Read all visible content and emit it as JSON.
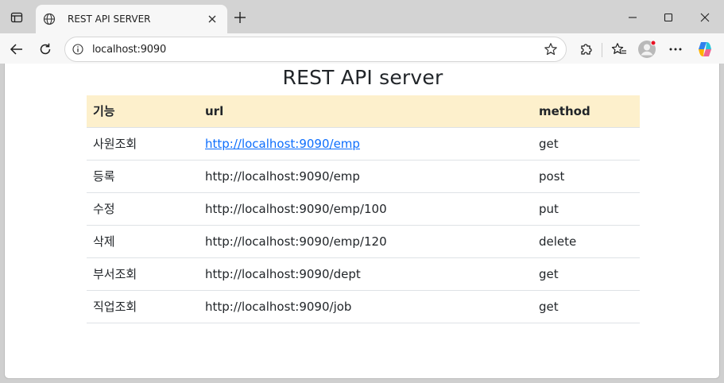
{
  "browser": {
    "tab_title": "REST API SERVER",
    "address": "localhost:9090",
    "icons": {
      "sidebar": "sidebar-icon",
      "favicon": "globe-icon",
      "close": "close-icon",
      "new_tab": "plus-icon",
      "back": "back-arrow-icon",
      "reload": "reload-icon",
      "info": "info-icon",
      "favorite": "star-icon",
      "extensions": "puzzle-icon",
      "favorites": "favorites-icon",
      "profile": "profile-icon",
      "menu": "more-icon",
      "copilot": "copilot-icon"
    }
  },
  "page": {
    "title": "REST API server",
    "table": {
      "headers": [
        "기능",
        "url",
        "method"
      ],
      "rows": [
        {
          "feature": "사원조회",
          "url": "http://localhost:9090/emp",
          "method": "get"
        },
        {
          "feature": "등록",
          "url": "http://localhost:9090/emp",
          "method": "post"
        },
        {
          "feature": "수정",
          "url": "http://localhost:9090/emp/100",
          "method": "put"
        },
        {
          "feature": "삭제",
          "url": "http://localhost:9090/emp/120",
          "method": "delete"
        },
        {
          "feature": "부서조회",
          "url": "http://localhost:9090/dept",
          "method": "get"
        },
        {
          "feature": "직업조회",
          "url": "http://localhost:9090/job",
          "method": "get"
        }
      ]
    }
  },
  "colors": {
    "header_bg": "#fdf0cc",
    "link": "#0d6efd",
    "notification_dot": "#e81123"
  }
}
